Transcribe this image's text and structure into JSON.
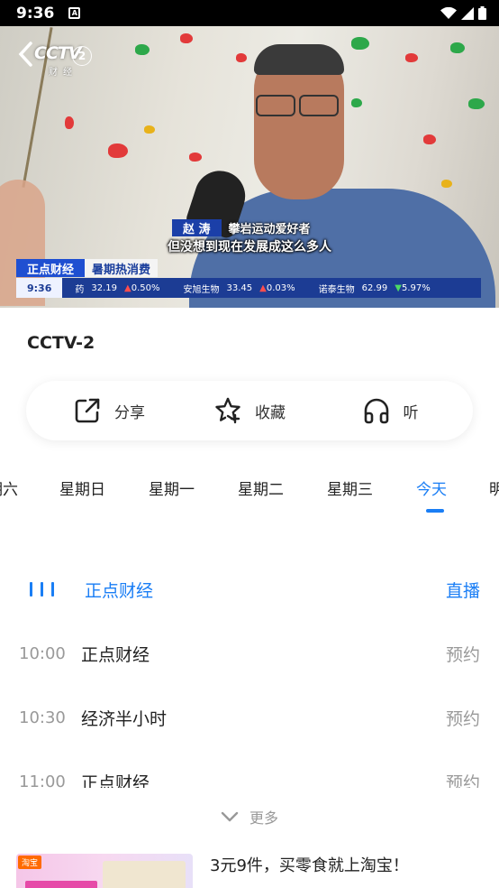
{
  "status_bar": {
    "time": "9:36",
    "notification_glyph": "A"
  },
  "video": {
    "logo": "CCTV",
    "channel_number": "2",
    "logo_sub": "财经",
    "caption": {
      "name": "赵 涛",
      "role": "攀岩运动爱好者",
      "quote": "但没想到现在发展成这么多人"
    },
    "lower_third": {
      "program": "正点财经",
      "tag": "暑期热消费"
    },
    "ticker": {
      "time": "9:36",
      "items": [
        {
          "name": "药",
          "price": "32.19",
          "change": "0.50%",
          "direction": "up"
        },
        {
          "name": "安旭生物",
          "price": "33.45",
          "change": "0.03%",
          "direction": "up"
        },
        {
          "name": "诺泰生物",
          "price": "62.99",
          "change": "5.97%",
          "direction": "down"
        }
      ]
    }
  },
  "channel": {
    "title": "CCTV-2"
  },
  "actions": {
    "share": "分享",
    "favorite": "收藏",
    "listen": "听"
  },
  "days": [
    "期六",
    "星期日",
    "星期一",
    "星期二",
    "星期三",
    "今天",
    "明"
  ],
  "active_day": "今天",
  "schedule": {
    "live": {
      "title": "正点财经",
      "action": "直播"
    },
    "items": [
      {
        "time": "10:00",
        "title": "正点财经",
        "action": "预约"
      },
      {
        "time": "10:30",
        "title": "经济半小时",
        "action": "预约"
      },
      {
        "time": "11:00",
        "title": "正点财经",
        "action": "预约"
      }
    ]
  },
  "more_label": "更多",
  "ad": {
    "badge": "淘宝",
    "title": "3元9件，买零食就上淘宝！"
  },
  "colors": {
    "accent": "#1a7ef5",
    "muted": "#999999",
    "ticker_bg": "#1c3c94"
  }
}
